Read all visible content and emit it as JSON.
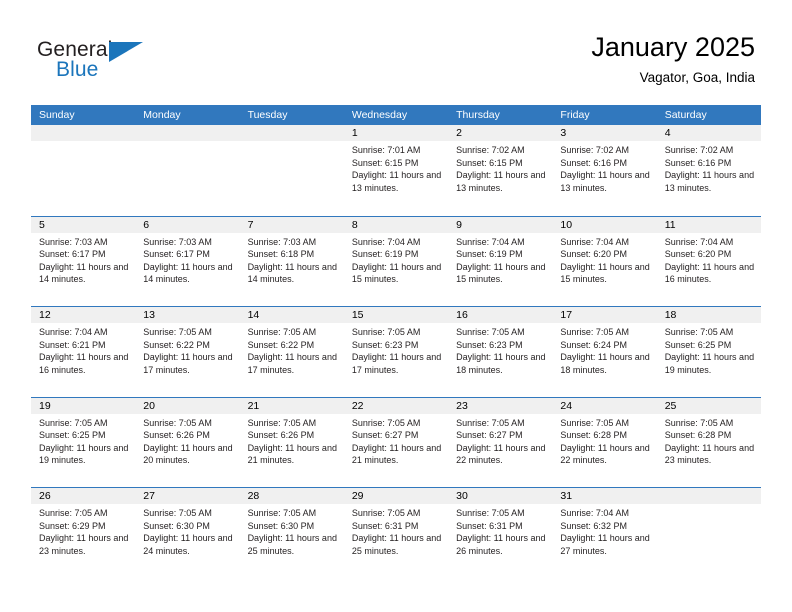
{
  "brand": {
    "name_part1": "General",
    "name_part2": "Blue",
    "accent_color": "#1b75bb",
    "triangle_icon": "triangle-icon"
  },
  "header": {
    "title": "January 2025",
    "subtitle": "Vagator, Goa, India"
  },
  "calendar": {
    "header_bg": "#3178be",
    "daynum_bg": "#f0f0f0",
    "weekdays": [
      "Sunday",
      "Monday",
      "Tuesday",
      "Wednesday",
      "Thursday",
      "Friday",
      "Saturday"
    ],
    "labels": {
      "sunrise": "Sunrise:",
      "sunset": "Sunset:",
      "daylight": "Daylight:"
    },
    "weeks": [
      [
        {
          "day": ""
        },
        {
          "day": ""
        },
        {
          "day": ""
        },
        {
          "day": "1",
          "sunrise": "Sunrise: 7:01 AM",
          "sunset": "Sunset: 6:15 PM",
          "daylight": "Daylight: 11 hours and 13 minutes."
        },
        {
          "day": "2",
          "sunrise": "Sunrise: 7:02 AM",
          "sunset": "Sunset: 6:15 PM",
          "daylight": "Daylight: 11 hours and 13 minutes."
        },
        {
          "day": "3",
          "sunrise": "Sunrise: 7:02 AM",
          "sunset": "Sunset: 6:16 PM",
          "daylight": "Daylight: 11 hours and 13 minutes."
        },
        {
          "day": "4",
          "sunrise": "Sunrise: 7:02 AM",
          "sunset": "Sunset: 6:16 PM",
          "daylight": "Daylight: 11 hours and 13 minutes."
        }
      ],
      [
        {
          "day": "5",
          "sunrise": "Sunrise: 7:03 AM",
          "sunset": "Sunset: 6:17 PM",
          "daylight": "Daylight: 11 hours and 14 minutes."
        },
        {
          "day": "6",
          "sunrise": "Sunrise: 7:03 AM",
          "sunset": "Sunset: 6:17 PM",
          "daylight": "Daylight: 11 hours and 14 minutes."
        },
        {
          "day": "7",
          "sunrise": "Sunrise: 7:03 AM",
          "sunset": "Sunset: 6:18 PM",
          "daylight": "Daylight: 11 hours and 14 minutes."
        },
        {
          "day": "8",
          "sunrise": "Sunrise: 7:04 AM",
          "sunset": "Sunset: 6:19 PM",
          "daylight": "Daylight: 11 hours and 15 minutes."
        },
        {
          "day": "9",
          "sunrise": "Sunrise: 7:04 AM",
          "sunset": "Sunset: 6:19 PM",
          "daylight": "Daylight: 11 hours and 15 minutes."
        },
        {
          "day": "10",
          "sunrise": "Sunrise: 7:04 AM",
          "sunset": "Sunset: 6:20 PM",
          "daylight": "Daylight: 11 hours and 15 minutes."
        },
        {
          "day": "11",
          "sunrise": "Sunrise: 7:04 AM",
          "sunset": "Sunset: 6:20 PM",
          "daylight": "Daylight: 11 hours and 16 minutes."
        }
      ],
      [
        {
          "day": "12",
          "sunrise": "Sunrise: 7:04 AM",
          "sunset": "Sunset: 6:21 PM",
          "daylight": "Daylight: 11 hours and 16 minutes."
        },
        {
          "day": "13",
          "sunrise": "Sunrise: 7:05 AM",
          "sunset": "Sunset: 6:22 PM",
          "daylight": "Daylight: 11 hours and 17 minutes."
        },
        {
          "day": "14",
          "sunrise": "Sunrise: 7:05 AM",
          "sunset": "Sunset: 6:22 PM",
          "daylight": "Daylight: 11 hours and 17 minutes."
        },
        {
          "day": "15",
          "sunrise": "Sunrise: 7:05 AM",
          "sunset": "Sunset: 6:23 PM",
          "daylight": "Daylight: 11 hours and 17 minutes."
        },
        {
          "day": "16",
          "sunrise": "Sunrise: 7:05 AM",
          "sunset": "Sunset: 6:23 PM",
          "daylight": "Daylight: 11 hours and 18 minutes."
        },
        {
          "day": "17",
          "sunrise": "Sunrise: 7:05 AM",
          "sunset": "Sunset: 6:24 PM",
          "daylight": "Daylight: 11 hours and 18 minutes."
        },
        {
          "day": "18",
          "sunrise": "Sunrise: 7:05 AM",
          "sunset": "Sunset: 6:25 PM",
          "daylight": "Daylight: 11 hours and 19 minutes."
        }
      ],
      [
        {
          "day": "19",
          "sunrise": "Sunrise: 7:05 AM",
          "sunset": "Sunset: 6:25 PM",
          "daylight": "Daylight: 11 hours and 19 minutes."
        },
        {
          "day": "20",
          "sunrise": "Sunrise: 7:05 AM",
          "sunset": "Sunset: 6:26 PM",
          "daylight": "Daylight: 11 hours and 20 minutes."
        },
        {
          "day": "21",
          "sunrise": "Sunrise: 7:05 AM",
          "sunset": "Sunset: 6:26 PM",
          "daylight": "Daylight: 11 hours and 21 minutes."
        },
        {
          "day": "22",
          "sunrise": "Sunrise: 7:05 AM",
          "sunset": "Sunset: 6:27 PM",
          "daylight": "Daylight: 11 hours and 21 minutes."
        },
        {
          "day": "23",
          "sunrise": "Sunrise: 7:05 AM",
          "sunset": "Sunset: 6:27 PM",
          "daylight": "Daylight: 11 hours and 22 minutes."
        },
        {
          "day": "24",
          "sunrise": "Sunrise: 7:05 AM",
          "sunset": "Sunset: 6:28 PM",
          "daylight": "Daylight: 11 hours and 22 minutes."
        },
        {
          "day": "25",
          "sunrise": "Sunrise: 7:05 AM",
          "sunset": "Sunset: 6:28 PM",
          "daylight": "Daylight: 11 hours and 23 minutes."
        }
      ],
      [
        {
          "day": "26",
          "sunrise": "Sunrise: 7:05 AM",
          "sunset": "Sunset: 6:29 PM",
          "daylight": "Daylight: 11 hours and 23 minutes."
        },
        {
          "day": "27",
          "sunrise": "Sunrise: 7:05 AM",
          "sunset": "Sunset: 6:30 PM",
          "daylight": "Daylight: 11 hours and 24 minutes."
        },
        {
          "day": "28",
          "sunrise": "Sunrise: 7:05 AM",
          "sunset": "Sunset: 6:30 PM",
          "daylight": "Daylight: 11 hours and 25 minutes."
        },
        {
          "day": "29",
          "sunrise": "Sunrise: 7:05 AM",
          "sunset": "Sunset: 6:31 PM",
          "daylight": "Daylight: 11 hours and 25 minutes."
        },
        {
          "day": "30",
          "sunrise": "Sunrise: 7:05 AM",
          "sunset": "Sunset: 6:31 PM",
          "daylight": "Daylight: 11 hours and 26 minutes."
        },
        {
          "day": "31",
          "sunrise": "Sunrise: 7:04 AM",
          "sunset": "Sunset: 6:32 PM",
          "daylight": "Daylight: 11 hours and 27 minutes."
        },
        {
          "day": ""
        }
      ]
    ]
  }
}
